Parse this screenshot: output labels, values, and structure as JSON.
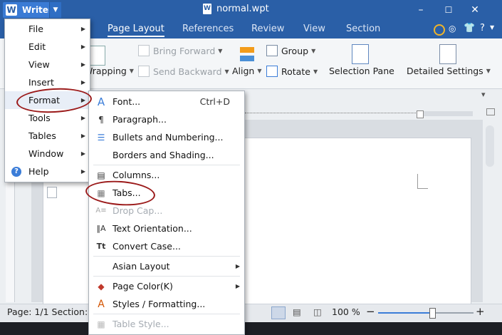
{
  "window": {
    "app_button": "Writer",
    "doc_title": "normal.wpt",
    "controls": [
      "–",
      "☐",
      "✕"
    ]
  },
  "tabs": [
    "Page Layout",
    "References",
    "Review",
    "View",
    "Section"
  ],
  "ribbon": {
    "bring_forward": "Bring Forward",
    "send_backward": "Send Backward",
    "wrapping": "Wrapping",
    "align": "Align",
    "group": "Group",
    "rotate": "Rotate",
    "selection_pane": "Selection Pane",
    "detailed_settings": "Detailed Settings"
  },
  "main_menu": {
    "items": [
      "File",
      "Edit",
      "View",
      "Insert",
      "Format",
      "Tools",
      "Tables",
      "Window",
      "Help"
    ]
  },
  "format_menu": {
    "items": [
      {
        "label": "Font...",
        "shortcut": "Ctrl+D",
        "icon": "A"
      },
      {
        "label": "Paragraph...",
        "icon": "¶"
      },
      {
        "label": "Bullets and Numbering...",
        "icon": "☰"
      },
      {
        "label": "Borders and Shading...",
        "icon": ""
      },
      {
        "label": "Columns...",
        "icon": "▤"
      },
      {
        "label": "Tabs...",
        "icon": "▦"
      },
      {
        "label": "Drop Cap...",
        "icon": "A≡"
      },
      {
        "label": "Text Orientation...",
        "icon": "‖A"
      },
      {
        "label": "Convert Case...",
        "icon": "Tt"
      },
      {
        "label": "Asian Layout",
        "icon": ""
      },
      {
        "label": "Page Color(K)",
        "icon": "◆"
      },
      {
        "label": "Styles / Formatting...",
        "icon": "A"
      },
      {
        "label": "Table Style...",
        "icon": "▦"
      }
    ]
  },
  "status": {
    "page": "Page: 1/1 Section:",
    "zoom": "100 %",
    "zoom_level": 0.57
  },
  "colors": {
    "title_blue": "#2a5fa7",
    "annotation_red": "#9b1a1a"
  }
}
